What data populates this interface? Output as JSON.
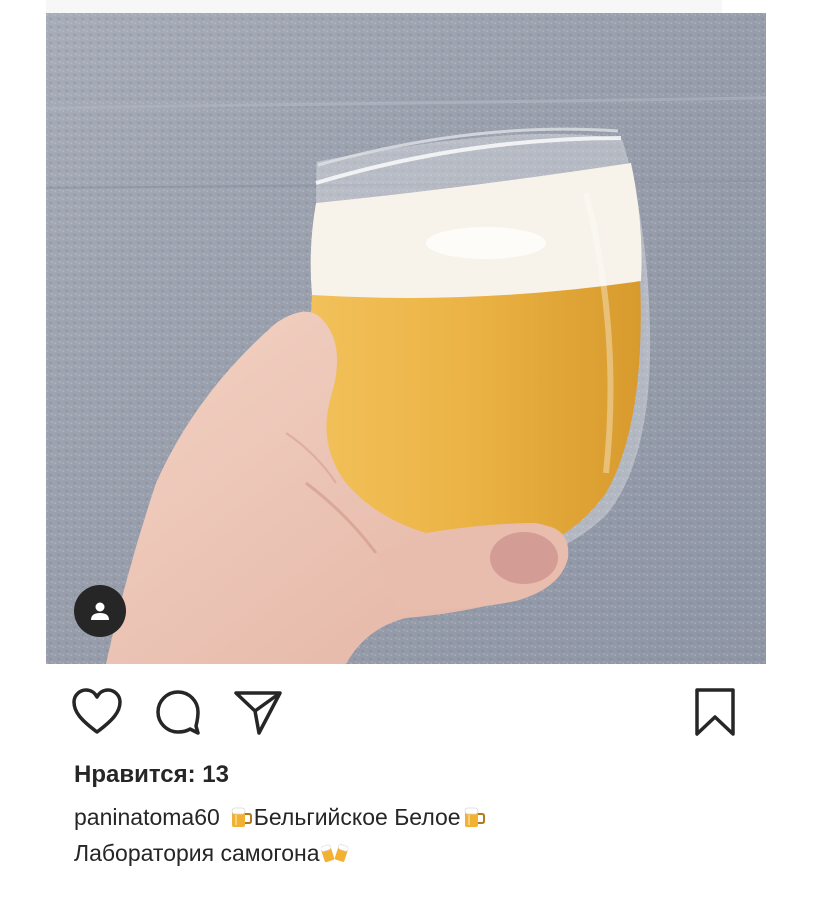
{
  "post": {
    "image": {
      "subject": "hand holding a stemless glass of cloudy golden beer with white foam",
      "background": "grey textured stone wall"
    },
    "user_tag_icon": "person-icon",
    "actions": {
      "like_icon": "heart-icon",
      "comment_icon": "speech-bubble-icon",
      "share_icon": "paper-plane-icon",
      "save_icon": "bookmark-icon"
    },
    "likes_text": "Нравится: 13",
    "caption": {
      "username": "paninatoma60",
      "line1_text": "Бельгийское Белое",
      "line2_text": "Лаборатория самогона",
      "beer_emoji": "beer-mug-emoji",
      "clinking_emoji": "clinking-beer-mugs-emoji"
    }
  },
  "colors": {
    "text": "#262626",
    "icon": "#262626",
    "beer": "#e9a93a",
    "foam": "#f7f3ea",
    "wall": "#9aa0ad"
  }
}
